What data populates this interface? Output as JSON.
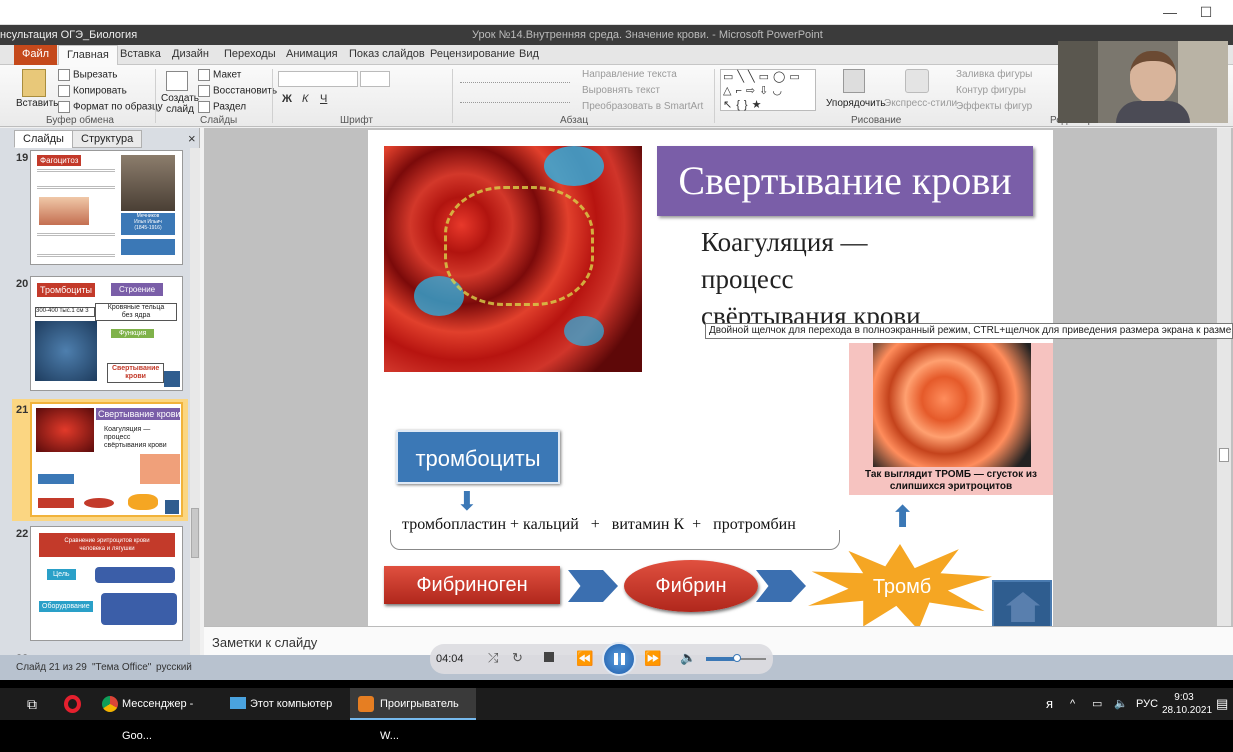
{
  "window": {
    "minimize": "—",
    "maximize": "☐"
  },
  "ppt": {
    "title_left": "нсультация ОГЭ_Биология",
    "title_center": "Урок №14.Внутренняя среда. Значение крови. - Microsoft PowerPoint",
    "tabs": [
      "Файл",
      "Главная",
      "Вставка",
      "Дизайн",
      "Переходы",
      "Анимация",
      "Показ слайдов",
      "Рецензирование",
      "Вид"
    ],
    "ribbon": {
      "paste": "Вставить",
      "cut": "Вырезать",
      "copy": "Копировать",
      "format_painter": "Формат по образцу",
      "clipboard_group": "Буфер обмена",
      "new_slide": "Создать\nслайд",
      "layout": "Макет",
      "reset": "Восстановить",
      "section": "Раздел",
      "slides_group": "Слайды",
      "font_group": "Шрифт",
      "text_direction": "Направление текста",
      "align_text": "Выровнять текст",
      "smartart": "Преобразовать в SmartArt",
      "paragraph_group": "Абзац",
      "arrange": "Упорядочить",
      "quick_styles": "Экспресс-стили",
      "shape_fill": "Заливка фигуры",
      "shape_outline": "Контур фигуры",
      "shape_effects": "Эффекты фигур",
      "drawing_group": "Рисование",
      "editing_group": "Редактирование"
    },
    "panel_tabs": [
      "Слайды",
      "Структура"
    ],
    "thumbs": [
      {
        "num": "19",
        "title": "Фагоцитоз",
        "caption": "Мечников\nИлья Ильич\n(1845-1916)"
      },
      {
        "num": "20",
        "title": "Тромбоциты",
        "structure": "Строение",
        "cells": "Кровяные тельца\nбез ядра",
        "count": "300-400 тыс.1 см 3",
        "function": "Функция",
        "clotting": "Свертывание\nкрови"
      },
      {
        "num": "21",
        "title": "Свертывание крови",
        "text": "Коагуляция —\nпроцесс\nсвёртывания крови"
      },
      {
        "num": "22",
        "title": "Сравнение эритроцитов крови\nчеловека и лягушки",
        "goal": "Цель",
        "equipment": "Оборудование"
      },
      {
        "num": "23"
      }
    ],
    "slide": {
      "title": "Свертывание крови",
      "text_line1": "Коагуляция —",
      "text_line2": "процесс",
      "text_line3": "свёртывания крови",
      "tooltip": "Двойной щелчок для перехода в полноэкранный режим, CTRL+щелчок для приведения размера экрана к размеру ви",
      "platelets": "тромбоциты",
      "formula": "тромбопластин + кальций   +   витамин К  +   протромбин",
      "fibrinogen": "Фибриноген",
      "fibrin": "Фибрин",
      "thromb": "Тромб",
      "photo_caption": "Так выглядит ТРОМБ — сгусток из\nслипшихся эритроцитов"
    },
    "notes_placeholder": "Заметки к слайду",
    "status": {
      "slide_of": "Слайд 21 из 29",
      "theme": "\"Тема Office\"",
      "lang": "русский"
    }
  },
  "media": {
    "time": "04:04"
  },
  "taskbar": {
    "items": [
      "Мессенджер - Goo...",
      "Этот компьютер",
      "Проигрыватель W..."
    ],
    "lang": "РУС",
    "time": "9:03",
    "date": "28.10.2021"
  }
}
